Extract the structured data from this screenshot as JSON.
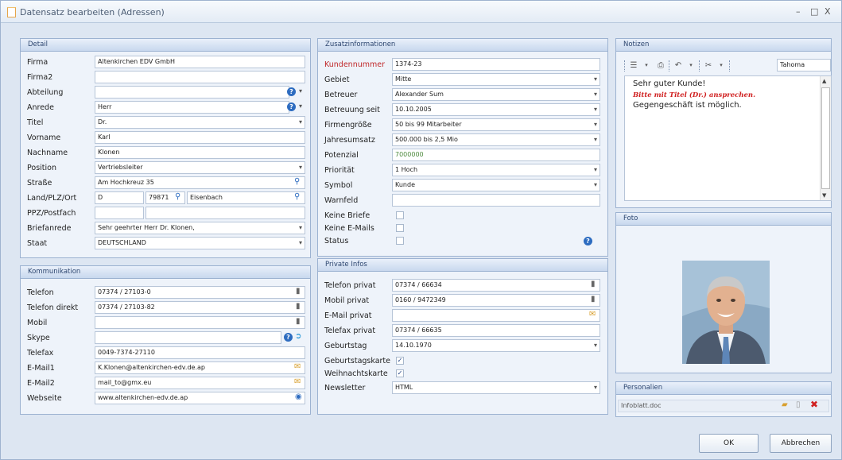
{
  "window": {
    "title": "Datensatz bearbeiten (Adressen)",
    "controls": [
      "–",
      "□",
      "X"
    ]
  },
  "detail": {
    "header": "Detail",
    "labels": {
      "firma": "Firma",
      "firma2": "Firma2",
      "abteilung": "Abteilung",
      "anrede": "Anrede",
      "titel": "Titel",
      "vorname": "Vorname",
      "nachname": "Nachname",
      "position": "Position",
      "strasse": "Straße",
      "land_plz_ort": "Land/PLZ/Ort",
      "pfz_postfach": "PPZ/Postfach",
      "briefanrede": "Briefanrede",
      "staat": "Staat"
    },
    "values": {
      "firma": "Altenkirchen EDV GmbH",
      "firma2": "",
      "abteilung": "",
      "anrede": "Herr",
      "titel": "Dr.",
      "vorname": "Karl",
      "nachname": "Klonen",
      "position": "Vertriebsleiter",
      "strasse": "Am Hochkreuz 35",
      "land": "D",
      "plz": "79871",
      "ort": "Eisenbach",
      "pfz": "",
      "postfach": "",
      "briefanrede": "Sehr geehrter Herr Dr. Klonen,",
      "staat": "DEUTSCHLAND"
    }
  },
  "kommunikation": {
    "header": "Kommunikation",
    "labels": {
      "telefon": "Telefon",
      "telefon_direkt": "Telefon direkt",
      "mobil": "Mobil",
      "skype": "Skype",
      "telefax": "Telefax",
      "email1": "E-Mail1",
      "email2": "E-Mail2",
      "webseite": "Webseite"
    },
    "values": {
      "telefon": "07374 / 27103-0",
      "telefon_direkt": "07374 / 27103-82",
      "mobil": "",
      "skype": "",
      "telefax": "0049-7374-27110",
      "email1": "K.Klonen@altenkirchen-edv.de.ap",
      "email2": "mail_to@gmx.eu",
      "webseite": "www.altenkirchen-edv.de.ap"
    }
  },
  "zusatz": {
    "header": "Zusatzinformationen",
    "labels": {
      "kundennummer": "Kundennummer",
      "gebiet": "Gebiet",
      "betreuer": "Betreuer",
      "betreuung_seit": "Betreuung seit",
      "firmengroesse": "Firmengröße",
      "jahresumsatz": "Jahresumsatz",
      "potenzial": "Potenzial",
      "prioritaet": "Priorität",
      "symbol": "Symbol",
      "warnfeld": "Warnfeld",
      "keine_briefe": "Keine Briefe",
      "keine_emails": "Keine E-Mails",
      "status": "Status"
    },
    "values": {
      "kundennummer": "1374-23",
      "gebiet": "Mitte",
      "betreuer": "Alexander Sum",
      "betreuung_seit": "10.10.2005",
      "firmengroesse": "50 bis 99 Mitarbeiter",
      "jahresumsatz": "500.000 bis 2,5 Mio",
      "potenzial": "7000000",
      "prioritaet": "1 Hoch",
      "symbol": "Kunde",
      "warnfeld": ""
    }
  },
  "privat": {
    "header": "Private Infos",
    "labels": {
      "telefon_privat": "Telefon privat",
      "mobil_privat": "Mobil privat",
      "email_privat": "E-Mail privat",
      "telefax_privat": "Telefax privat",
      "geburtstag": "Geburtstag",
      "geburtstagskarte": "Geburtstagskarte",
      "weihnachtskarte": "Weihnachtskarte",
      "newsletter": "Newsletter"
    },
    "values": {
      "telefon_privat": "07374 / 66634",
      "mobil_privat": "0160 / 9472349",
      "email_privat": "",
      "telefax_privat": "07374 / 66635",
      "geburtstag": "14.10.1970",
      "newsletter": "HTML"
    }
  },
  "notizen": {
    "header": "Notizen",
    "font": "Tahoma",
    "line1": "Sehr guter Kunde!",
    "line2": "Bitte mit Titel (Dr.) ansprechen.",
    "line3": "Gegengeschäft ist möglich."
  },
  "foto": {
    "header": "Foto"
  },
  "personalien": {
    "header": "Personalien",
    "file": "Infoblatt.doc"
  },
  "buttons": {
    "ok": "OK",
    "abbrechen": "Abbrechen"
  },
  "colors": {
    "accent": "#2d6cc0",
    "required_label": "#c0282a",
    "panel_border": "#9cb2d1"
  }
}
